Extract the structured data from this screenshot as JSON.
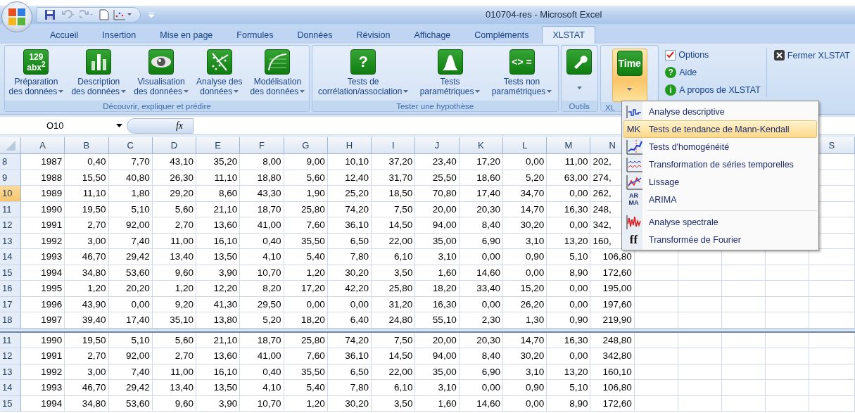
{
  "window": {
    "title": "010704-res - Microsoft Excel"
  },
  "tabs": [
    {
      "label": "Accueil",
      "selected": false
    },
    {
      "label": "Insertion",
      "selected": false
    },
    {
      "label": "Mise en page",
      "selected": false
    },
    {
      "label": "Formules",
      "selected": false
    },
    {
      "label": "Données",
      "selected": false
    },
    {
      "label": "Révision",
      "selected": false
    },
    {
      "label": "Affichage",
      "selected": false
    },
    {
      "label": "Compléments",
      "selected": false
    },
    {
      "label": "XLSTAT",
      "selected": true
    }
  ],
  "ribbon": {
    "groups": [
      {
        "label": "Découvrir, expliquer et prédire",
        "buttons": [
          {
            "lines": [
              "Préparation",
              "des données"
            ],
            "icon_text": "129 abx$^{2}$",
            "pressed": false
          },
          {
            "lines": [
              "Description",
              "des données"
            ],
            "pressed": false
          },
          {
            "lines": [
              "Visualisation",
              "des données"
            ],
            "pressed": false
          },
          {
            "lines": [
              "Analyse des",
              "données"
            ],
            "pressed": false
          },
          {
            "lines": [
              "Modélisation",
              "des données"
            ],
            "pressed": false
          }
        ]
      },
      {
        "label": "Tester une hypothèse",
        "buttons": [
          {
            "lines": [
              "Tests de",
              "corrélation/association"
            ],
            "icon_text": "?",
            "pressed": false
          },
          {
            "lines": [
              "Tests",
              "paramétriques"
            ],
            "pressed": false
          },
          {
            "lines": [
              "Tests non",
              "paramétriques"
            ],
            "icon_text": "<> =",
            "pressed": false
          }
        ]
      },
      {
        "label": "Outils",
        "buttons": [
          {
            "pressed": false
          }
        ]
      },
      {
        "label": "XL",
        "buttons": [
          {
            "icon_text": "Time",
            "pressed": true
          }
        ]
      }
    ],
    "side_items": [
      {
        "kind": "checkbox",
        "label": "Options",
        "checked": true
      },
      {
        "kind": "help",
        "label": "Aide",
        "icon_text": "?"
      },
      {
        "kind": "info",
        "label": "A propos de XLSTAT",
        "icon_text": "i"
      }
    ],
    "close_button": {
      "label": "Fermer XLSTAT"
    }
  },
  "formula_bar": {
    "name_box": "O10",
    "function_label": "fx"
  },
  "grid": {
    "columns": [
      "A",
      "B",
      "C",
      "D",
      "E",
      "F",
      "G",
      "H",
      "I",
      "J",
      "K",
      "L",
      "M",
      "N"
    ],
    "last_column": "S",
    "upper_rows": [
      {
        "header": "8",
        "selected": false,
        "overlapped": true,
        "cells": [
          "1987",
          "0,40",
          "7,70",
          "43,10",
          "35,20",
          "8,00",
          "9,00",
          "10,10",
          "37,20",
          "23,40",
          "17,20",
          "0,00",
          "11,00",
          "202,"
        ]
      },
      {
        "header": "9",
        "selected": false,
        "overlapped": true,
        "cells": [
          "1988",
          "15,50",
          "40,80",
          "26,30",
          "11,10",
          "18,80",
          "5,60",
          "12,40",
          "31,70",
          "25,50",
          "18,60",
          "5,20",
          "63,00",
          "274,"
        ]
      },
      {
        "header": "10",
        "selected": true,
        "overlapped": true,
        "cells": [
          "1989",
          "11,10",
          "1,80",
          "29,20",
          "8,60",
          "43,30",
          "1,90",
          "25,20",
          "18,50",
          "70,80",
          "17,40",
          "34,70",
          "0,00",
          "262,"
        ]
      },
      {
        "header": "11",
        "selected": false,
        "overlapped": true,
        "cells": [
          "1990",
          "19,50",
          "5,10",
          "5,60",
          "21,10",
          "18,70",
          "25,80",
          "74,20",
          "7,50",
          "20,00",
          "20,30",
          "14,70",
          "16,30",
          "248,"
        ]
      },
      {
        "header": "12",
        "selected": false,
        "overlapped": true,
        "cells": [
          "1991",
          "2,70",
          "92,00",
          "2,70",
          "13,60",
          "41,00",
          "7,60",
          "36,10",
          "14,50",
          "94,00",
          "8,40",
          "30,20",
          "0,00",
          "342,"
        ]
      },
      {
        "header": "13",
        "selected": false,
        "overlapped": true,
        "cells": [
          "1992",
          "3,00",
          "7,40",
          "11,00",
          "16,10",
          "0,40",
          "35,50",
          "6,50",
          "22,00",
          "35,00",
          "6,90",
          "3,10",
          "13,20",
          "160,"
        ]
      },
      {
        "header": "14",
        "selected": false,
        "overlapped": false,
        "cells": [
          "1993",
          "46,70",
          "29,42",
          "13,40",
          "13,50",
          "4,10",
          "5,40",
          "7,80",
          "6,10",
          "3,10",
          "0,00",
          "0,90",
          "5,10",
          "106,80"
        ]
      },
      {
        "header": "15",
        "selected": false,
        "overlapped": false,
        "cells": [
          "1994",
          "34,80",
          "53,60",
          "9,60",
          "3,90",
          "10,70",
          "1,20",
          "30,20",
          "3,50",
          "1,60",
          "14,60",
          "0,00",
          "8,90",
          "172,60"
        ]
      },
      {
        "header": "16",
        "selected": false,
        "overlapped": false,
        "cells": [
          "1995",
          "1,20",
          "20,20",
          "1,20",
          "12,20",
          "8,20",
          "17,20",
          "42,20",
          "25,80",
          "18,20",
          "33,40",
          "15,20",
          "0,00",
          "195,00"
        ]
      },
      {
        "header": "17",
        "selected": false,
        "overlapped": false,
        "cells": [
          "1996",
          "43,90",
          "0,00",
          "9,20",
          "41,30",
          "29,50",
          "0,00",
          "0,00",
          "31,20",
          "16,30",
          "0,00",
          "26,20",
          "0,00",
          "197,60"
        ]
      },
      {
        "header": "18",
        "selected": false,
        "overlapped": false,
        "cells": [
          "1997",
          "39,40",
          "17,40",
          "35,10",
          "13,80",
          "5,20",
          "18,20",
          "6,40",
          "24,80",
          "55,10",
          "2,30",
          "1,30",
          "0,90",
          "219,90"
        ]
      }
    ],
    "lower_rows": [
      {
        "header": "11",
        "selected": false,
        "overlapped": false,
        "cells": [
          "1990",
          "19,50",
          "5,10",
          "5,60",
          "21,10",
          "18,70",
          "25,80",
          "74,20",
          "7,50",
          "20,00",
          "20,30",
          "14,70",
          "16,30",
          "248,80"
        ]
      },
      {
        "header": "12",
        "selected": false,
        "overlapped": false,
        "cells": [
          "1991",
          "2,70",
          "92,00",
          "2,70",
          "13,60",
          "41,00",
          "7,60",
          "36,10",
          "14,50",
          "94,00",
          "8,40",
          "30,20",
          "0,00",
          "342,80"
        ]
      },
      {
        "header": "13",
        "selected": false,
        "overlapped": false,
        "cells": [
          "1992",
          "3,00",
          "7,40",
          "11,00",
          "16,10",
          "0,40",
          "35,50",
          "6,50",
          "22,00",
          "35,00",
          "6,90",
          "3,10",
          "13,20",
          "160,10"
        ]
      },
      {
        "header": "14",
        "selected": false,
        "overlapped": false,
        "cells": [
          "1993",
          "46,70",
          "29,42",
          "13,40",
          "13,50",
          "4,10",
          "5,40",
          "7,80",
          "6,10",
          "3,10",
          "0,00",
          "0,90",
          "5,10",
          "106,80"
        ]
      },
      {
        "header": "15",
        "selected": false,
        "overlapped": false,
        "cells": [
          "1994",
          "34,80",
          "53,60",
          "9,60",
          "3,90",
          "10,70",
          "1,20",
          "30,20",
          "3,50",
          "1,60",
          "14,60",
          "0,00",
          "8,90",
          "172,60"
        ]
      }
    ]
  },
  "time_menu": {
    "items": [
      {
        "label": "Analyse descriptive",
        "selected": false,
        "separator_before": false
      },
      {
        "label": "Tests de tendance de Mann-Kendall",
        "selected": true,
        "separator_before": false,
        "icon_text": "MK"
      },
      {
        "label": "Tests d'homogénéité",
        "selected": false,
        "separator_before": false
      },
      {
        "label": "Transformation de séries temporelles",
        "selected": false,
        "separator_before": false
      },
      {
        "label": "Lissage",
        "selected": false,
        "separator_before": false
      },
      {
        "label": "ARIMA",
        "selected": false,
        "separator_before": false,
        "icon_text": "AR MA"
      },
      {
        "label": "Analyse spectrale",
        "selected": false,
        "separator_before": true
      },
      {
        "label": "Transformée de Fourier",
        "selected": false,
        "separator_before": false,
        "icon_text": "ff"
      }
    ]
  }
}
